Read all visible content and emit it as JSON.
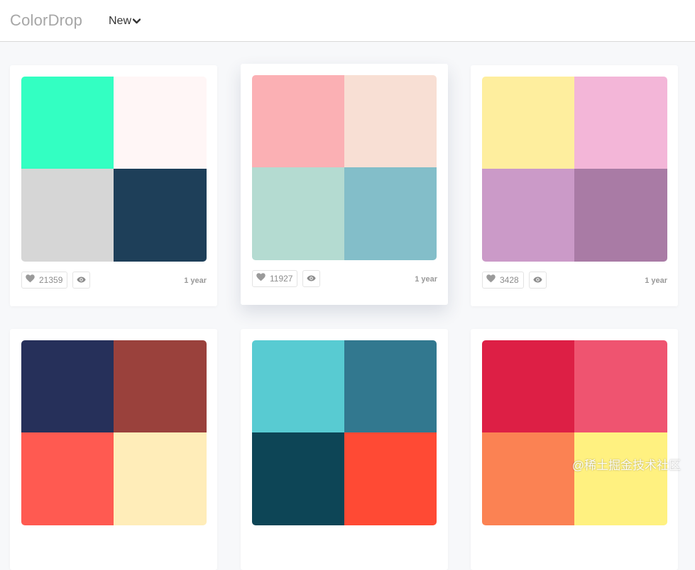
{
  "header": {
    "logo": "ColorDrop",
    "sort_label": "New"
  },
  "cards": [
    {
      "colors": [
        "#33ffc2",
        "#fff6f6",
        "#d6d6d6",
        "#1e3f59"
      ],
      "likes": "21359",
      "age": "1 year"
    },
    {
      "colors": [
        "#fbb0b4",
        "#f8dfd4",
        "#b4dbd1",
        "#83bec9"
      ],
      "likes": "11927",
      "age": "1 year"
    },
    {
      "colors": [
        "#feee9e",
        "#f3b6d8",
        "#cb9ac8",
        "#a97ba5"
      ],
      "likes": "3428",
      "age": "1 year"
    },
    {
      "colors": [
        "#26305a",
        "#9a413c",
        "#ff5a51",
        "#ffedb9"
      ],
      "likes": "",
      "age": ""
    },
    {
      "colors": [
        "#58cbd2",
        "#32788f",
        "#0d4556",
        "#ff4a34"
      ],
      "likes": "",
      "age": ""
    },
    {
      "colors": [
        "#dd1f45",
        "#ef5470",
        "#fb8253",
        "#fff180"
      ],
      "likes": "",
      "age": ""
    }
  ],
  "icons": {
    "heart": "heart-icon",
    "view": "eye-icon",
    "chevron": "chevron-down-icon"
  },
  "watermark": "@稀土掘金技术社区"
}
